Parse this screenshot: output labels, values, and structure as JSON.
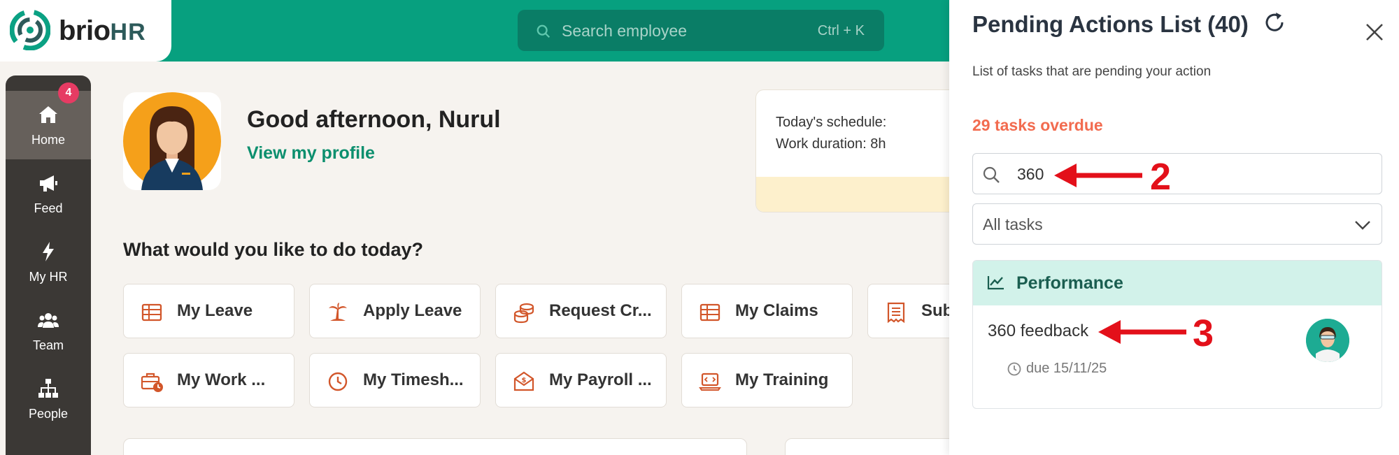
{
  "brand": {
    "name_part1": "brio",
    "name_part2": "HR",
    "accent": "#07a07f"
  },
  "search": {
    "placeholder": "Search employee",
    "shortcut": "Ctrl + K",
    "icon": "search-icon"
  },
  "sidebar": {
    "items": [
      {
        "label": "Home",
        "icon": "home-icon",
        "active": true
      },
      {
        "label": "Feed",
        "icon": "megaphone-icon",
        "badge": "4"
      },
      {
        "label": "My HR",
        "icon": "lightning-icon"
      },
      {
        "label": "Team",
        "icon": "team-icon"
      },
      {
        "label": "People",
        "icon": "org-chart-icon"
      }
    ]
  },
  "main": {
    "greeting": "Good afternoon, Nurul",
    "profile_link": "View my profile",
    "schedule": {
      "line1": "Today's schedule:",
      "line2": "Work duration: 8h"
    },
    "question": "What would you like to do today?",
    "actions": [
      {
        "label": "My Leave",
        "icon": "table-icon"
      },
      {
        "label": "Apply Leave",
        "icon": "palm-tree-icon"
      },
      {
        "label": "Request Cr...",
        "icon": "coins-icon"
      },
      {
        "label": "My Claims",
        "icon": "table-icon"
      },
      {
        "label": "Sub",
        "icon": "receipt-icon"
      },
      {
        "label": "My Work ...",
        "icon": "briefcase-clock-icon"
      },
      {
        "label": "My Timesh...",
        "icon": "clock-icon"
      },
      {
        "label": "My Payroll ...",
        "icon": "payroll-envelope-icon"
      },
      {
        "label": "My Training",
        "icon": "laptop-code-icon"
      }
    ]
  },
  "panel": {
    "title": "Pending Actions List (40)",
    "subtitle": "List of tasks that are pending your action",
    "overdue": "29 tasks overdue",
    "search_value": "360",
    "filter": "All tasks",
    "section": {
      "title": "Performance",
      "task": {
        "name": "360 feedback",
        "due": "due 15/11/25"
      }
    }
  },
  "annotations": {
    "arrow_2": "2",
    "arrow_3": "3",
    "color": "#e3101a"
  }
}
